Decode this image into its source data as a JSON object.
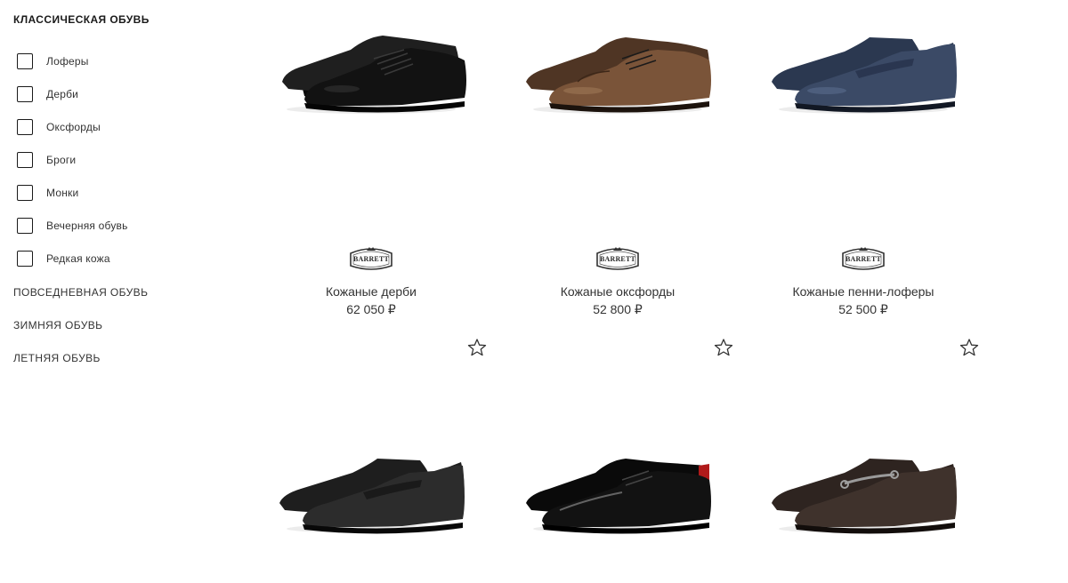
{
  "sidebar": {
    "category_title": "КЛАССИЧЕСКАЯ ОБУВЬ",
    "filters": [
      {
        "label": "Лоферы",
        "checked": false
      },
      {
        "label": "Дерби",
        "checked": false
      },
      {
        "label": "Оксфорды",
        "checked": false
      },
      {
        "label": "Броги",
        "checked": false
      },
      {
        "label": "Монки",
        "checked": false
      },
      {
        "label": "Вечерняя обувь",
        "checked": false
      },
      {
        "label": "Редкая кожа",
        "checked": false
      }
    ],
    "other_categories": [
      {
        "label": "ПОВСЕДНЕВНАЯ ОБУВЬ"
      },
      {
        "label": "ЗИМНЯЯ ОБУВЬ"
      },
      {
        "label": "ЛЕТНЯЯ ОБУВЬ"
      }
    ]
  },
  "products": [
    {
      "brand": "BARRETT",
      "name": "Кожаные дерби",
      "price": "62 050 ₽",
      "image_icon": "black-derby-shoe",
      "color": "#141414"
    },
    {
      "brand": "BARRETT",
      "name": "Кожаные оксфорды",
      "price": "52 800 ₽",
      "image_icon": "brown-oxford-shoe",
      "color": "#6b4a33"
    },
    {
      "brand": "BARRETT",
      "name": "Кожаные пенни-лоферы",
      "price": "52 500 ₽",
      "image_icon": "navy-penny-loafer",
      "color": "#34425a"
    },
    {
      "image_icon": "black-penny-loafer",
      "color": "#262626"
    },
    {
      "image_icon": "patent-oxford-shoe",
      "color": "#0d0d0d"
    },
    {
      "image_icon": "brown-horsebit-loafer",
      "color": "#3a2d28"
    }
  ],
  "icons": {
    "favorite": "star-outline-icon",
    "checkbox": "checkbox-icon",
    "brand_logo": "barrett-logo"
  }
}
